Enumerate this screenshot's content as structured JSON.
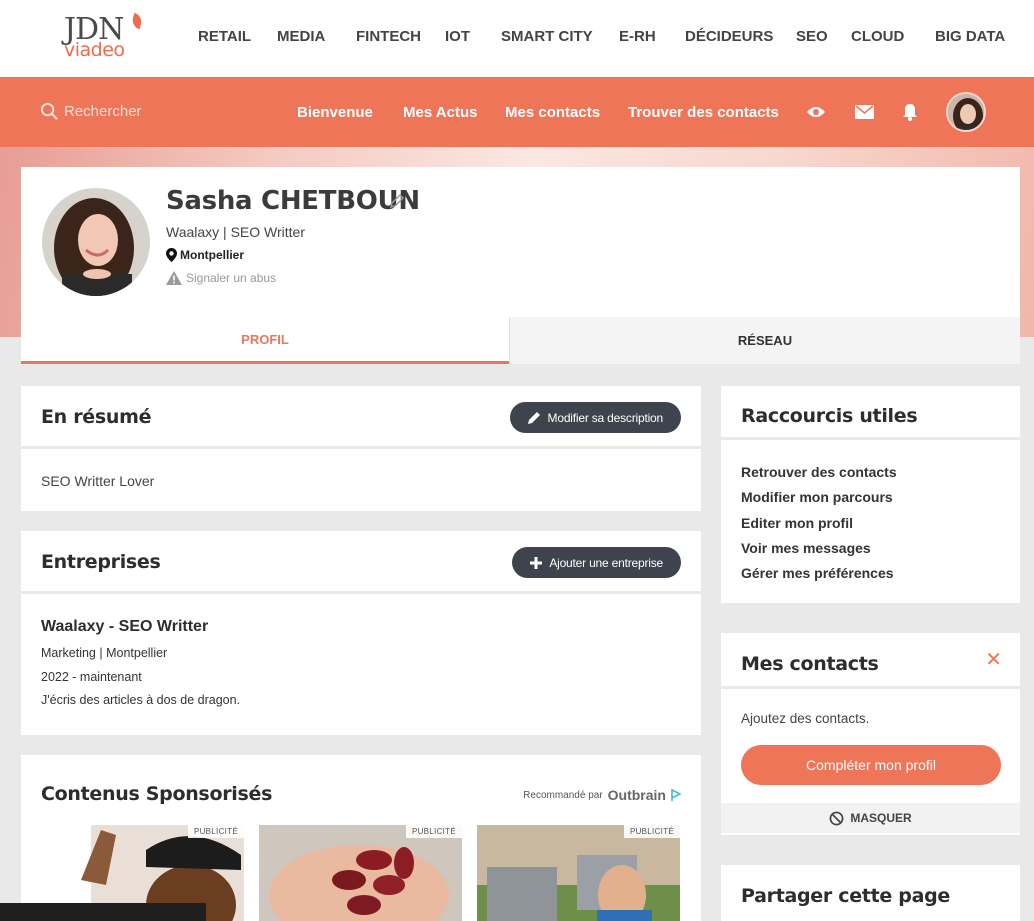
{
  "logo": {
    "line1": "JDN",
    "line2": "viadeo"
  },
  "top_nav": [
    "RETAIL",
    "MEDIA",
    "FINTECH",
    "IOT",
    "SMART CITY",
    "E-RH",
    "DÉCIDEURS",
    "SEO",
    "CLOUD",
    "BIG DATA"
  ],
  "subnav": {
    "search_placeholder": "Rechercher",
    "links": [
      "Bienvenue",
      "Mes Actus",
      "Mes contacts",
      "Trouver des contacts"
    ]
  },
  "profile": {
    "name": "Sasha CHETBOUN",
    "headline": "Waalaxy | SEO Writter",
    "location": "Montpellier",
    "report": "Signaler un abus"
  },
  "tabs": [
    "PROFIL",
    "RÉSEAU"
  ],
  "resume": {
    "title": "En résumé",
    "edit_label": "Modifier sa description",
    "text": "SEO Writter Lover"
  },
  "companies": {
    "title": "Entreprises",
    "add_label": "Ajouter une entreprise",
    "entry": {
      "name": "Waalaxy - SEO Writter",
      "meta": "Marketing | Montpellier",
      "period": "2022 - maintenant",
      "desc": "J'écris des articles à dos de dragon."
    }
  },
  "sponsored": {
    "title": "Contenus Sponsorisés",
    "recommended": "Recommandé par",
    "brand": "Outbrain",
    "badge": "PUBLICITÉ"
  },
  "shortcuts": {
    "title": "Raccourcis utiles",
    "links": [
      "Retrouver des contacts",
      "Modifier mon parcours",
      "Editer mon profil",
      "Voir mes messages",
      "Gérer mes préférences"
    ]
  },
  "my_contacts": {
    "title": "Mes contacts",
    "text": "Ajoutez des contacts.",
    "button": "Compléter mon profil",
    "hide": "MASQUER"
  },
  "share": {
    "title": "Partager cette page"
  },
  "colors": {
    "accent": "#ef7559",
    "dark_button": "#3e434d",
    "background": "#e9e9ea"
  }
}
